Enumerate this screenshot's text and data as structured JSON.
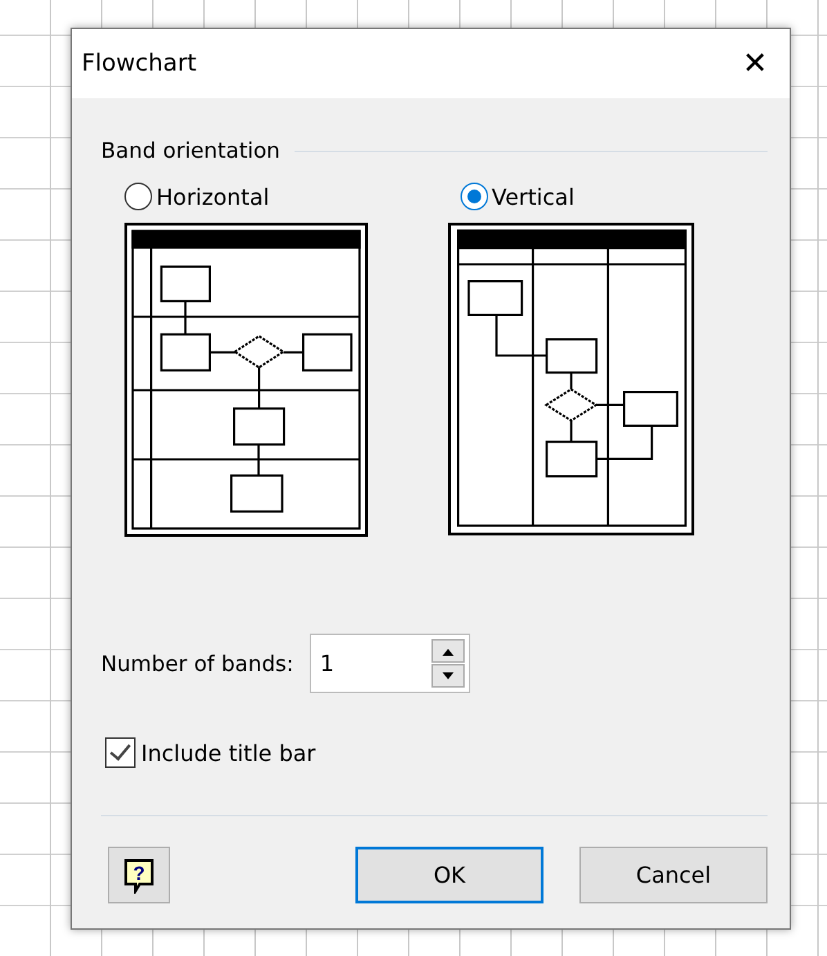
{
  "window": {
    "title": "Flowchart",
    "close": "✕"
  },
  "band_orientation": {
    "heading": "Band orientation",
    "options": [
      {
        "kind": "horizontal",
        "label": "Horizontal",
        "selected": false
      },
      {
        "kind": "vertical",
        "label": "Vertical",
        "selected": true
      }
    ]
  },
  "number_of_bands": {
    "label": "Number of bands:",
    "value": "1"
  },
  "include_title_bar": {
    "label": "Include title bar",
    "checked": true
  },
  "help_button": {
    "glyph": "?"
  },
  "buttons": [
    {
      "label": "OK",
      "default": true
    },
    {
      "label": "Cancel",
      "default": false
    }
  ]
}
